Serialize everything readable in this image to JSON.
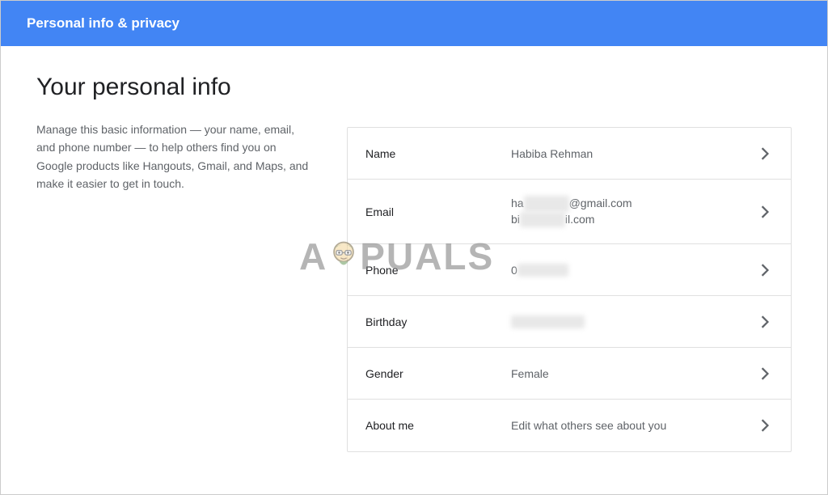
{
  "header": {
    "title": "Personal info & privacy"
  },
  "page": {
    "title": "Your personal info",
    "description": "Manage this basic information — your name, email, and phone number — to help others find you on Google products like Hangouts, Gmail, and Maps, and make it easier to get in touch."
  },
  "rows": {
    "name": {
      "label": "Name",
      "value": "Habiba Rehman"
    },
    "email": {
      "label": "Email",
      "value1_pre": "ha",
      "value1_red": "xxxxxxxx",
      "value1_suf": "@gmail.com",
      "value2_pre": "bi",
      "value2_red": "xxxxxxxx",
      "value2_suf": "il.com"
    },
    "phone": {
      "label": "Phone",
      "value_pre": "0",
      "value_red": "xxxxxxxxx"
    },
    "birthday": {
      "label": "Birthday",
      "value_red": "xxxxxxxxxxxxx"
    },
    "gender": {
      "label": "Gender",
      "value": "Female"
    },
    "about": {
      "label": "About me",
      "value": "Edit what others see about you"
    }
  },
  "watermark": {
    "prefix": "A",
    "suffix": "PUALS"
  }
}
